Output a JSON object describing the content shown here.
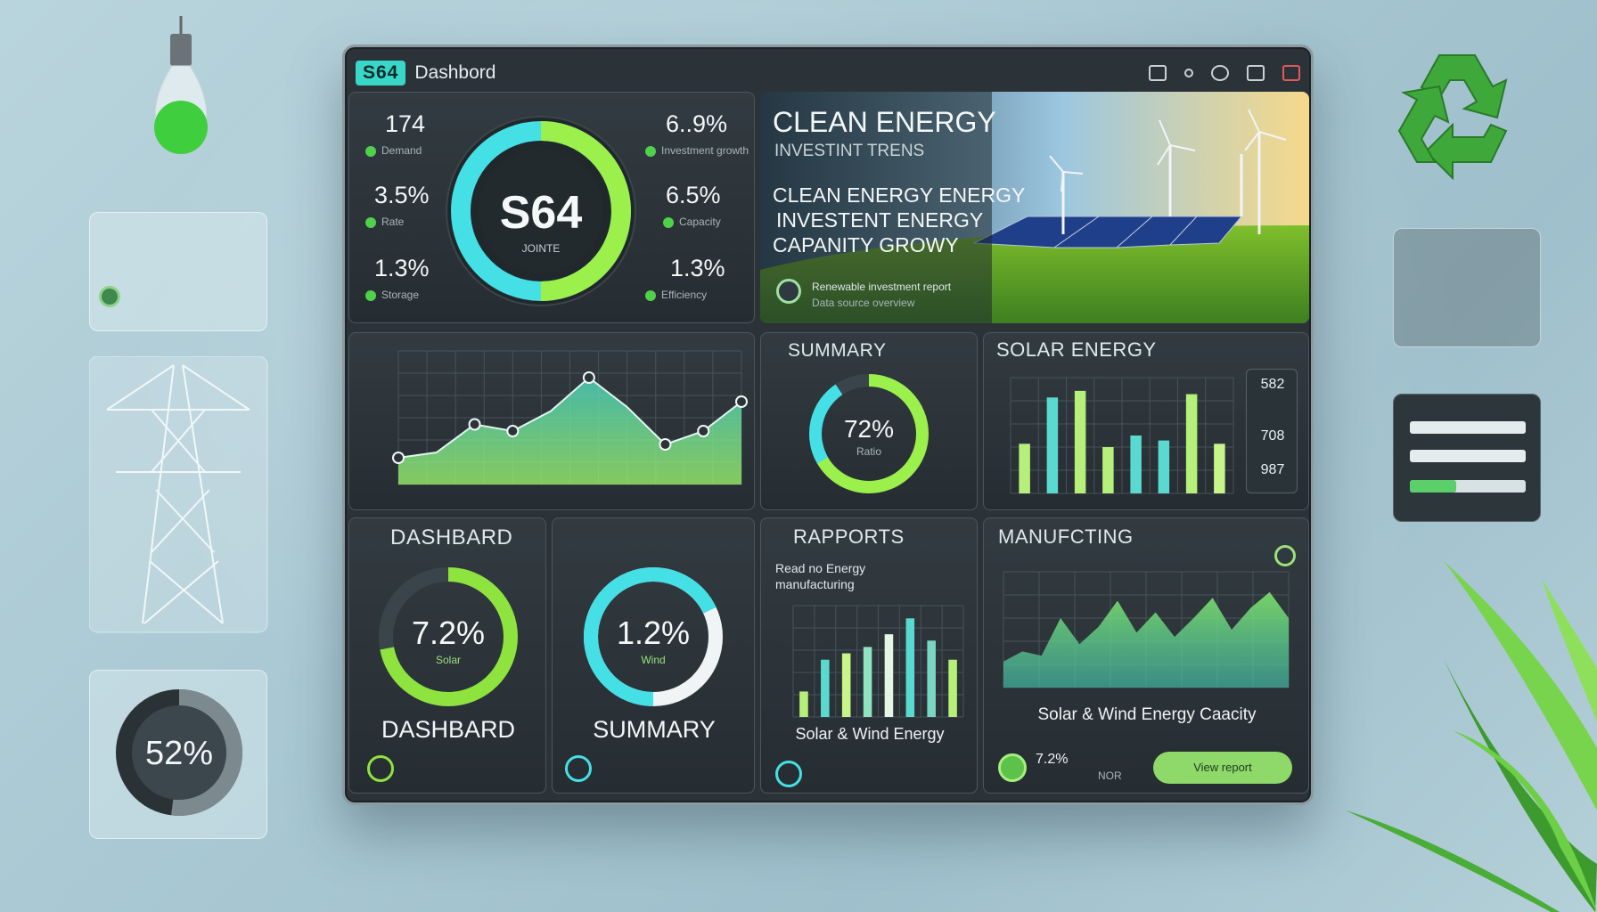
{
  "window": {
    "logo": "S64",
    "title": "Dashbord"
  },
  "top_left": {
    "center_value": "S64",
    "center_sub": "JOINTE",
    "center_ring_fraction": 0.5,
    "metrics": [
      {
        "value": "174",
        "label": "Demand"
      },
      {
        "value": "3.5%",
        "label": "Rate"
      },
      {
        "value": "1.3%",
        "label": "Storage"
      },
      {
        "value": "6..9%",
        "label": "Investment growth"
      },
      {
        "value": "6.5%",
        "label": "Capacity"
      },
      {
        "value": "1.3%",
        "label": "Efficiency"
      }
    ]
  },
  "hero": {
    "title": "CLEAN ENERGY",
    "subtitle": "INVESTINT TRENS",
    "lines": [
      "CLEAN ENERGY ENERGY",
      "INVESTENT ENERGY",
      "CAPANITY GROWY"
    ],
    "footer_1": "Renewable investment report",
    "footer_2": "Data source overview"
  },
  "line_panel": {
    "chart_data": {
      "type": "area",
      "x": [
        1,
        2,
        3,
        4,
        5,
        6,
        7,
        8,
        9,
        10
      ],
      "values": [
        20,
        24,
        45,
        40,
        55,
        80,
        58,
        30,
        40,
        62
      ],
      "ylim": [
        0,
        100
      ],
      "markers": [
        1,
        3,
        4,
        6,
        8,
        9,
        10
      ]
    }
  },
  "summary": {
    "title": "SUMMARY",
    "value": "72%",
    "sub": "Ratio",
    "ring_fraction": 0.72
  },
  "solar": {
    "title": "SOLAR ENERGY",
    "side_values": [
      "582",
      "708",
      "987"
    ],
    "chart_data": {
      "type": "bar",
      "values": [
        30,
        58,
        62,
        28,
        35,
        32,
        60,
        30
      ],
      "ylim": [
        0,
        70
      ]
    }
  },
  "dashboard_card": {
    "header": "DASHBARD",
    "value": "7.2%",
    "sub": "Solar",
    "label": "DASHBARD",
    "ring_fraction": 0.72
  },
  "summary_card": {
    "value": "1.2%",
    "sub": "Wind",
    "label": "SUMMARY",
    "ring_fraction": 0.68
  },
  "reports": {
    "title": "RAPPORTS",
    "note_1": "Read no Energy",
    "note_2": "manufacturing",
    "caption": "Solar & Wind Energy",
    "chart_data": {
      "type": "bar",
      "values": [
        8,
        18,
        20,
        22,
        26,
        31,
        24,
        18
      ],
      "ylim": [
        0,
        35
      ]
    }
  },
  "manufacturing": {
    "title": "MANUFCTING",
    "caption": "Solar & Wind Energy Caacity",
    "footer_value": "7.2%",
    "footer_label": "NOR",
    "button_label": "View report",
    "chart_data": {
      "type": "area",
      "values": [
        18,
        25,
        22,
        48,
        30,
        42,
        60,
        38,
        52,
        35,
        48,
        62,
        40,
        55,
        66,
        48
      ],
      "ylim": [
        0,
        80
      ]
    }
  },
  "side": {
    "gauge_value": "52%",
    "gauge_fraction": 0.52
  },
  "colors": {
    "accent_green": "#7be05a",
    "accent_cyan": "#38d7e0",
    "panel": "#2b3338"
  }
}
